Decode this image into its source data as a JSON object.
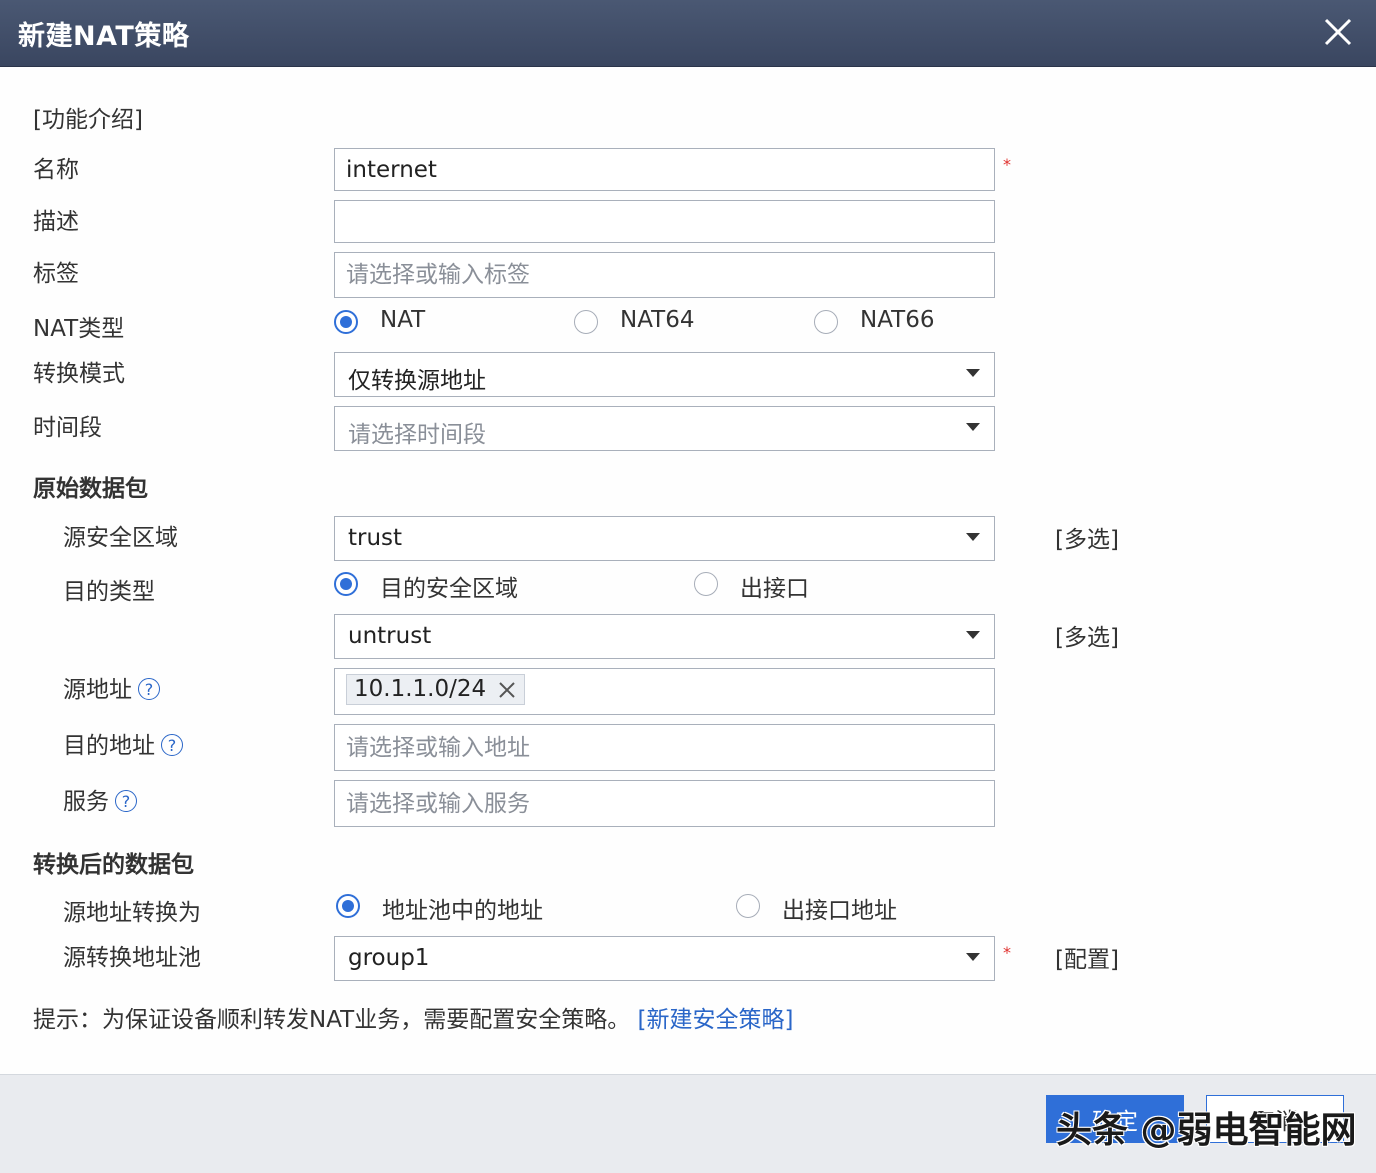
{
  "dialog": {
    "title": "新建NAT策略",
    "close_icon": "close-icon"
  },
  "help_link": "[功能介绍]",
  "form": {
    "name": {
      "label": "名称",
      "value": "internet",
      "required": "*"
    },
    "description": {
      "label": "描述",
      "value": ""
    },
    "tags": {
      "label": "标签",
      "placeholder": "请选择或输入标签"
    },
    "nat_type": {
      "label": "NAT类型",
      "options": [
        "NAT",
        "NAT64",
        "NAT66"
      ],
      "selected": "NAT"
    },
    "convert_mode": {
      "label": "转换模式",
      "value": "仅转换源地址"
    },
    "time_range": {
      "label": "时间段",
      "placeholder": "请选择时间段"
    }
  },
  "original_packet": {
    "heading": "原始数据包",
    "source_zone": {
      "label": "源安全区域",
      "value": "trust",
      "multi_link": "[多选]"
    },
    "dest_type": {
      "label": "目的类型",
      "options": [
        "目的安全区域",
        "出接口"
      ],
      "selected": "目的安全区域"
    },
    "dest_zone": {
      "value": "untrust",
      "multi_link": "[多选]"
    },
    "source_address": {
      "label": "源地址",
      "help": "?",
      "tag": "10.1.1.0/24"
    },
    "dest_address": {
      "label": "目的地址",
      "help": "?",
      "placeholder": "请选择或输入地址"
    },
    "service": {
      "label": "服务",
      "help": "?",
      "placeholder": "请选择或输入服务"
    }
  },
  "translated_packet": {
    "heading": "转换后的数据包",
    "source_convert_to": {
      "label": "源地址转换为",
      "options": [
        "地址池中的地址",
        "出接口地址"
      ],
      "selected": "地址池中的地址"
    },
    "source_pool": {
      "label": "源转换地址池",
      "value": "group1",
      "required": "*",
      "config_link": "[配置]"
    }
  },
  "hint": {
    "text": "提示：为保证设备顺利转发NAT业务，需要配置安全策略。",
    "link": "[新建安全策略]"
  },
  "footer": {
    "ok_label": "确定",
    "cancel_label": "取消"
  },
  "watermark": "头条 @弱电智能网",
  "colors": {
    "titlebar": "#3f4b66",
    "accent": "#2f6fd8",
    "link": "#2a66c8",
    "required": "#e0302d",
    "footer_bg": "#e9ebef"
  }
}
